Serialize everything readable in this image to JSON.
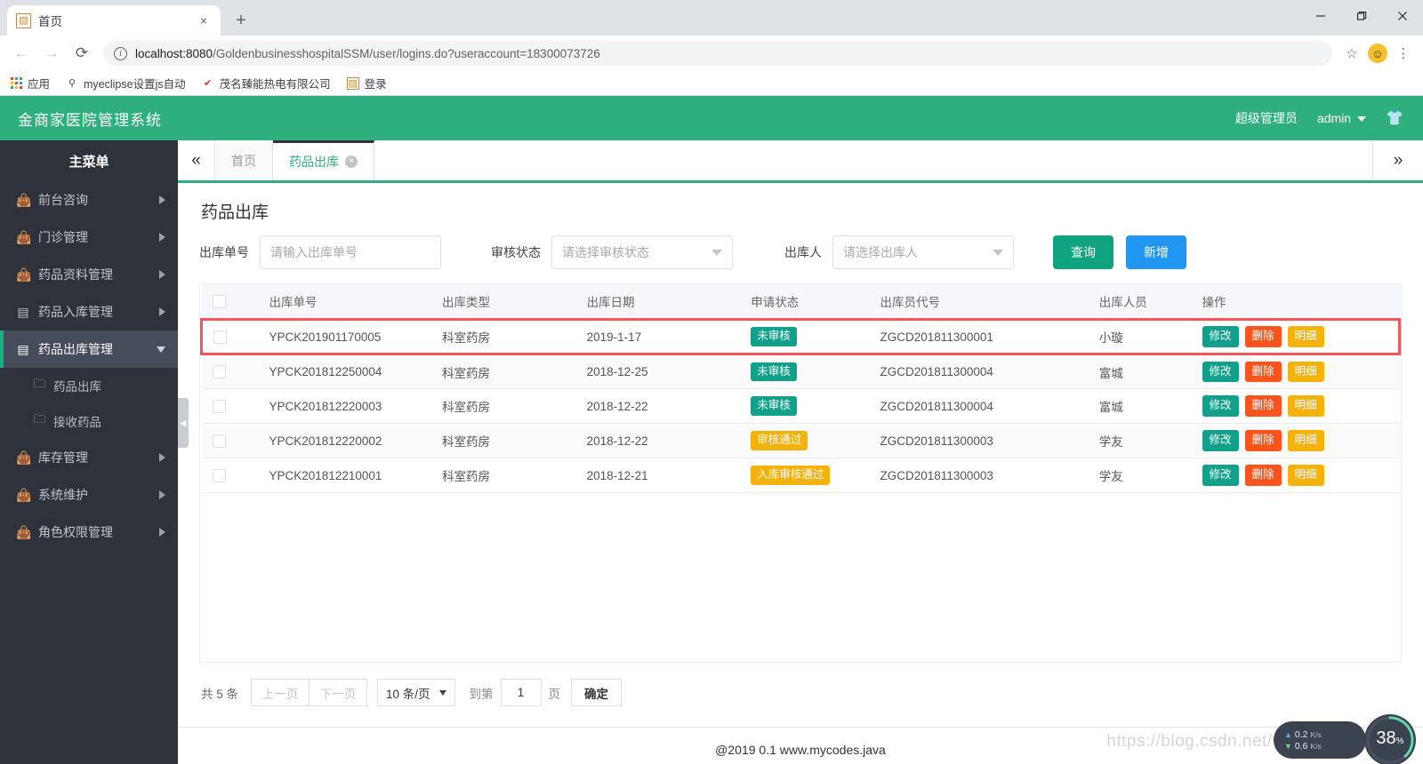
{
  "browser": {
    "tab": {
      "title": "首页",
      "favicon": "page-icon",
      "close_label": "×"
    },
    "new_tab_label": "+",
    "nav": {
      "back": "←",
      "forward": "→",
      "reload": "⟳"
    },
    "url": {
      "host": "localhost:8080",
      "rest": "/GoldenbusinesshospitalSSM/user/logins.do?useraccount=18300073726"
    },
    "star_label": "☆",
    "menu_label": "⋮",
    "bookmarks": [
      {
        "label": "应用",
        "icon": "apps-grid-icon"
      },
      {
        "label": "myeclipse设置js自动",
        "icon": "bookmark-icon"
      },
      {
        "label": "茂名臻能热电有限公司",
        "icon": "bookmark-icon"
      },
      {
        "label": "登录",
        "icon": "page-icon"
      }
    ]
  },
  "header": {
    "title": "金商家医院管理系统",
    "role": "超级管理员",
    "user": "admin",
    "shirt_icon": "👕"
  },
  "sidebar": {
    "heading": "主菜单",
    "items": [
      {
        "label": "前台咨询",
        "icon": "bag-icon",
        "active": false,
        "expanded": false
      },
      {
        "label": "门诊管理",
        "icon": "bag-icon",
        "active": false,
        "expanded": false
      },
      {
        "label": "药品资料管理",
        "icon": "bag-icon",
        "active": false,
        "expanded": false
      },
      {
        "label": "药品入库管理",
        "icon": "doc-icon",
        "active": false,
        "expanded": false
      },
      {
        "label": "药品出库管理",
        "icon": "doc-icon",
        "active": true,
        "expanded": true
      },
      {
        "label": "库存管理",
        "icon": "bag-icon",
        "active": false,
        "expanded": false
      },
      {
        "label": "系统维护",
        "icon": "bag-icon",
        "active": false,
        "expanded": false
      },
      {
        "label": "角色权限管理",
        "icon": "bag-icon",
        "active": false,
        "expanded": false
      }
    ],
    "submenu": [
      {
        "label": "药品出库",
        "icon": "folder-icon"
      },
      {
        "label": "接收药品",
        "icon": "folder-icon"
      }
    ]
  },
  "tabbar": {
    "collapse_icon": "«",
    "expand_icon": "»",
    "tabs": [
      {
        "label": "首页",
        "active": false,
        "closable": false
      },
      {
        "label": "药品出库",
        "active": true,
        "closable": true,
        "close_label": "×"
      }
    ]
  },
  "page": {
    "title": "药品出库",
    "filters": {
      "order_no": {
        "label": "出库单号",
        "placeholder": "请输入出库单号",
        "value": ""
      },
      "audit_state": {
        "label": "审核状态",
        "value": "请选择审核状态"
      },
      "operator": {
        "label": "出库人",
        "value": "请选择出库人"
      }
    },
    "buttons": {
      "query": "查询",
      "add": "新增"
    }
  },
  "table": {
    "columns": [
      "",
      "出库单号",
      "出库类型",
      "出库日期",
      "申请状态",
      "出库员代号",
      "出库人员",
      "操作"
    ],
    "actions": {
      "edit": "修改",
      "delete": "删除",
      "detail": "明细"
    },
    "rows": [
      {
        "order_no": "YPCK201901170005",
        "type": "科室药房",
        "date": "2019-1-17",
        "status": "未审核",
        "status_color": "teal",
        "code": "ZGCD201811300001",
        "person": "小璇",
        "highlighted": true
      },
      {
        "order_no": "YPCK201812250004",
        "type": "科室药房",
        "date": "2018-12-25",
        "status": "未审核",
        "status_color": "teal",
        "code": "ZGCD201811300004",
        "person": "富城",
        "highlighted": false
      },
      {
        "order_no": "YPCK201812220003",
        "type": "科室药房",
        "date": "2018-12-22",
        "status": "未审核",
        "status_color": "teal",
        "code": "ZGCD201811300004",
        "person": "富城",
        "highlighted": false
      },
      {
        "order_no": "YPCK201812220002",
        "type": "科室药房",
        "date": "2018-12-22",
        "status": "审核通过",
        "status_color": "amber",
        "code": "ZGCD201811300003",
        "person": "学友",
        "highlighted": false
      },
      {
        "order_no": "YPCK201812210001",
        "type": "科室药房",
        "date": "2018-12-21",
        "status": "入库审核通过",
        "status_color": "amber",
        "code": "ZGCD201811300003",
        "person": "学友",
        "highlighted": false
      }
    ]
  },
  "pagination": {
    "total": "共 5 条",
    "prev": "上一页",
    "next": "下一页",
    "page_size": "10 条/页",
    "jump_prefix": "到第",
    "page_value": "1",
    "jump_suffix": "页",
    "confirm": "确定"
  },
  "footer": {
    "text": "@2019 0.1 www.mycodes.java"
  },
  "watermark": {
    "text": "https://blog.csdn.net/weixin_42451089"
  },
  "widget": {
    "up_value": "0.2",
    "up_unit": "K/s",
    "down_value": "0.6",
    "down_unit": "K/s",
    "gauge_percent": "38",
    "gauge_symbol": "%",
    "gauge_color": "#5fd6a8"
  }
}
